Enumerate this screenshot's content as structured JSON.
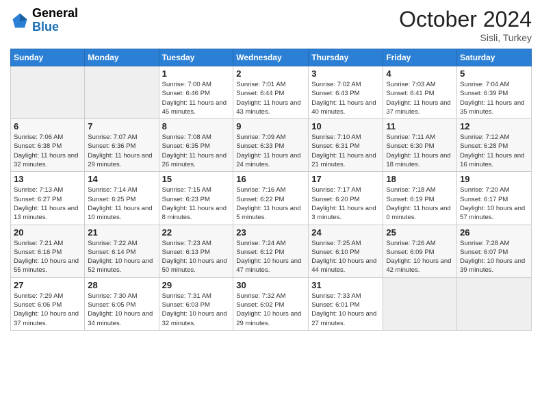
{
  "header": {
    "logo_general": "General",
    "logo_blue": "Blue",
    "month_title": "October 2024",
    "subtitle": "Sisli, Turkey"
  },
  "days_of_week": [
    "Sunday",
    "Monday",
    "Tuesday",
    "Wednesday",
    "Thursday",
    "Friday",
    "Saturday"
  ],
  "weeks": [
    [
      {
        "day": "",
        "info": ""
      },
      {
        "day": "",
        "info": ""
      },
      {
        "day": "1",
        "info": "Sunrise: 7:00 AM\nSunset: 6:46 PM\nDaylight: 11 hours and 45 minutes."
      },
      {
        "day": "2",
        "info": "Sunrise: 7:01 AM\nSunset: 6:44 PM\nDaylight: 11 hours and 43 minutes."
      },
      {
        "day": "3",
        "info": "Sunrise: 7:02 AM\nSunset: 6:43 PM\nDaylight: 11 hours and 40 minutes."
      },
      {
        "day": "4",
        "info": "Sunrise: 7:03 AM\nSunset: 6:41 PM\nDaylight: 11 hours and 37 minutes."
      },
      {
        "day": "5",
        "info": "Sunrise: 7:04 AM\nSunset: 6:39 PM\nDaylight: 11 hours and 35 minutes."
      }
    ],
    [
      {
        "day": "6",
        "info": "Sunrise: 7:06 AM\nSunset: 6:38 PM\nDaylight: 11 hours and 32 minutes."
      },
      {
        "day": "7",
        "info": "Sunrise: 7:07 AM\nSunset: 6:36 PM\nDaylight: 11 hours and 29 minutes."
      },
      {
        "day": "8",
        "info": "Sunrise: 7:08 AM\nSunset: 6:35 PM\nDaylight: 11 hours and 26 minutes."
      },
      {
        "day": "9",
        "info": "Sunrise: 7:09 AM\nSunset: 6:33 PM\nDaylight: 11 hours and 24 minutes."
      },
      {
        "day": "10",
        "info": "Sunrise: 7:10 AM\nSunset: 6:31 PM\nDaylight: 11 hours and 21 minutes."
      },
      {
        "day": "11",
        "info": "Sunrise: 7:11 AM\nSunset: 6:30 PM\nDaylight: 11 hours and 18 minutes."
      },
      {
        "day": "12",
        "info": "Sunrise: 7:12 AM\nSunset: 6:28 PM\nDaylight: 11 hours and 16 minutes."
      }
    ],
    [
      {
        "day": "13",
        "info": "Sunrise: 7:13 AM\nSunset: 6:27 PM\nDaylight: 11 hours and 13 minutes."
      },
      {
        "day": "14",
        "info": "Sunrise: 7:14 AM\nSunset: 6:25 PM\nDaylight: 11 hours and 10 minutes."
      },
      {
        "day": "15",
        "info": "Sunrise: 7:15 AM\nSunset: 6:23 PM\nDaylight: 11 hours and 8 minutes."
      },
      {
        "day": "16",
        "info": "Sunrise: 7:16 AM\nSunset: 6:22 PM\nDaylight: 11 hours and 5 minutes."
      },
      {
        "day": "17",
        "info": "Sunrise: 7:17 AM\nSunset: 6:20 PM\nDaylight: 11 hours and 3 minutes."
      },
      {
        "day": "18",
        "info": "Sunrise: 7:18 AM\nSunset: 6:19 PM\nDaylight: 11 hours and 0 minutes."
      },
      {
        "day": "19",
        "info": "Sunrise: 7:20 AM\nSunset: 6:17 PM\nDaylight: 10 hours and 57 minutes."
      }
    ],
    [
      {
        "day": "20",
        "info": "Sunrise: 7:21 AM\nSunset: 6:16 PM\nDaylight: 10 hours and 55 minutes."
      },
      {
        "day": "21",
        "info": "Sunrise: 7:22 AM\nSunset: 6:14 PM\nDaylight: 10 hours and 52 minutes."
      },
      {
        "day": "22",
        "info": "Sunrise: 7:23 AM\nSunset: 6:13 PM\nDaylight: 10 hours and 50 minutes."
      },
      {
        "day": "23",
        "info": "Sunrise: 7:24 AM\nSunset: 6:12 PM\nDaylight: 10 hours and 47 minutes."
      },
      {
        "day": "24",
        "info": "Sunrise: 7:25 AM\nSunset: 6:10 PM\nDaylight: 10 hours and 44 minutes."
      },
      {
        "day": "25",
        "info": "Sunrise: 7:26 AM\nSunset: 6:09 PM\nDaylight: 10 hours and 42 minutes."
      },
      {
        "day": "26",
        "info": "Sunrise: 7:28 AM\nSunset: 6:07 PM\nDaylight: 10 hours and 39 minutes."
      }
    ],
    [
      {
        "day": "27",
        "info": "Sunrise: 7:29 AM\nSunset: 6:06 PM\nDaylight: 10 hours and 37 minutes."
      },
      {
        "day": "28",
        "info": "Sunrise: 7:30 AM\nSunset: 6:05 PM\nDaylight: 10 hours and 34 minutes."
      },
      {
        "day": "29",
        "info": "Sunrise: 7:31 AM\nSunset: 6:03 PM\nDaylight: 10 hours and 32 minutes."
      },
      {
        "day": "30",
        "info": "Sunrise: 7:32 AM\nSunset: 6:02 PM\nDaylight: 10 hours and 29 minutes."
      },
      {
        "day": "31",
        "info": "Sunrise: 7:33 AM\nSunset: 6:01 PM\nDaylight: 10 hours and 27 minutes."
      },
      {
        "day": "",
        "info": ""
      },
      {
        "day": "",
        "info": ""
      }
    ]
  ]
}
